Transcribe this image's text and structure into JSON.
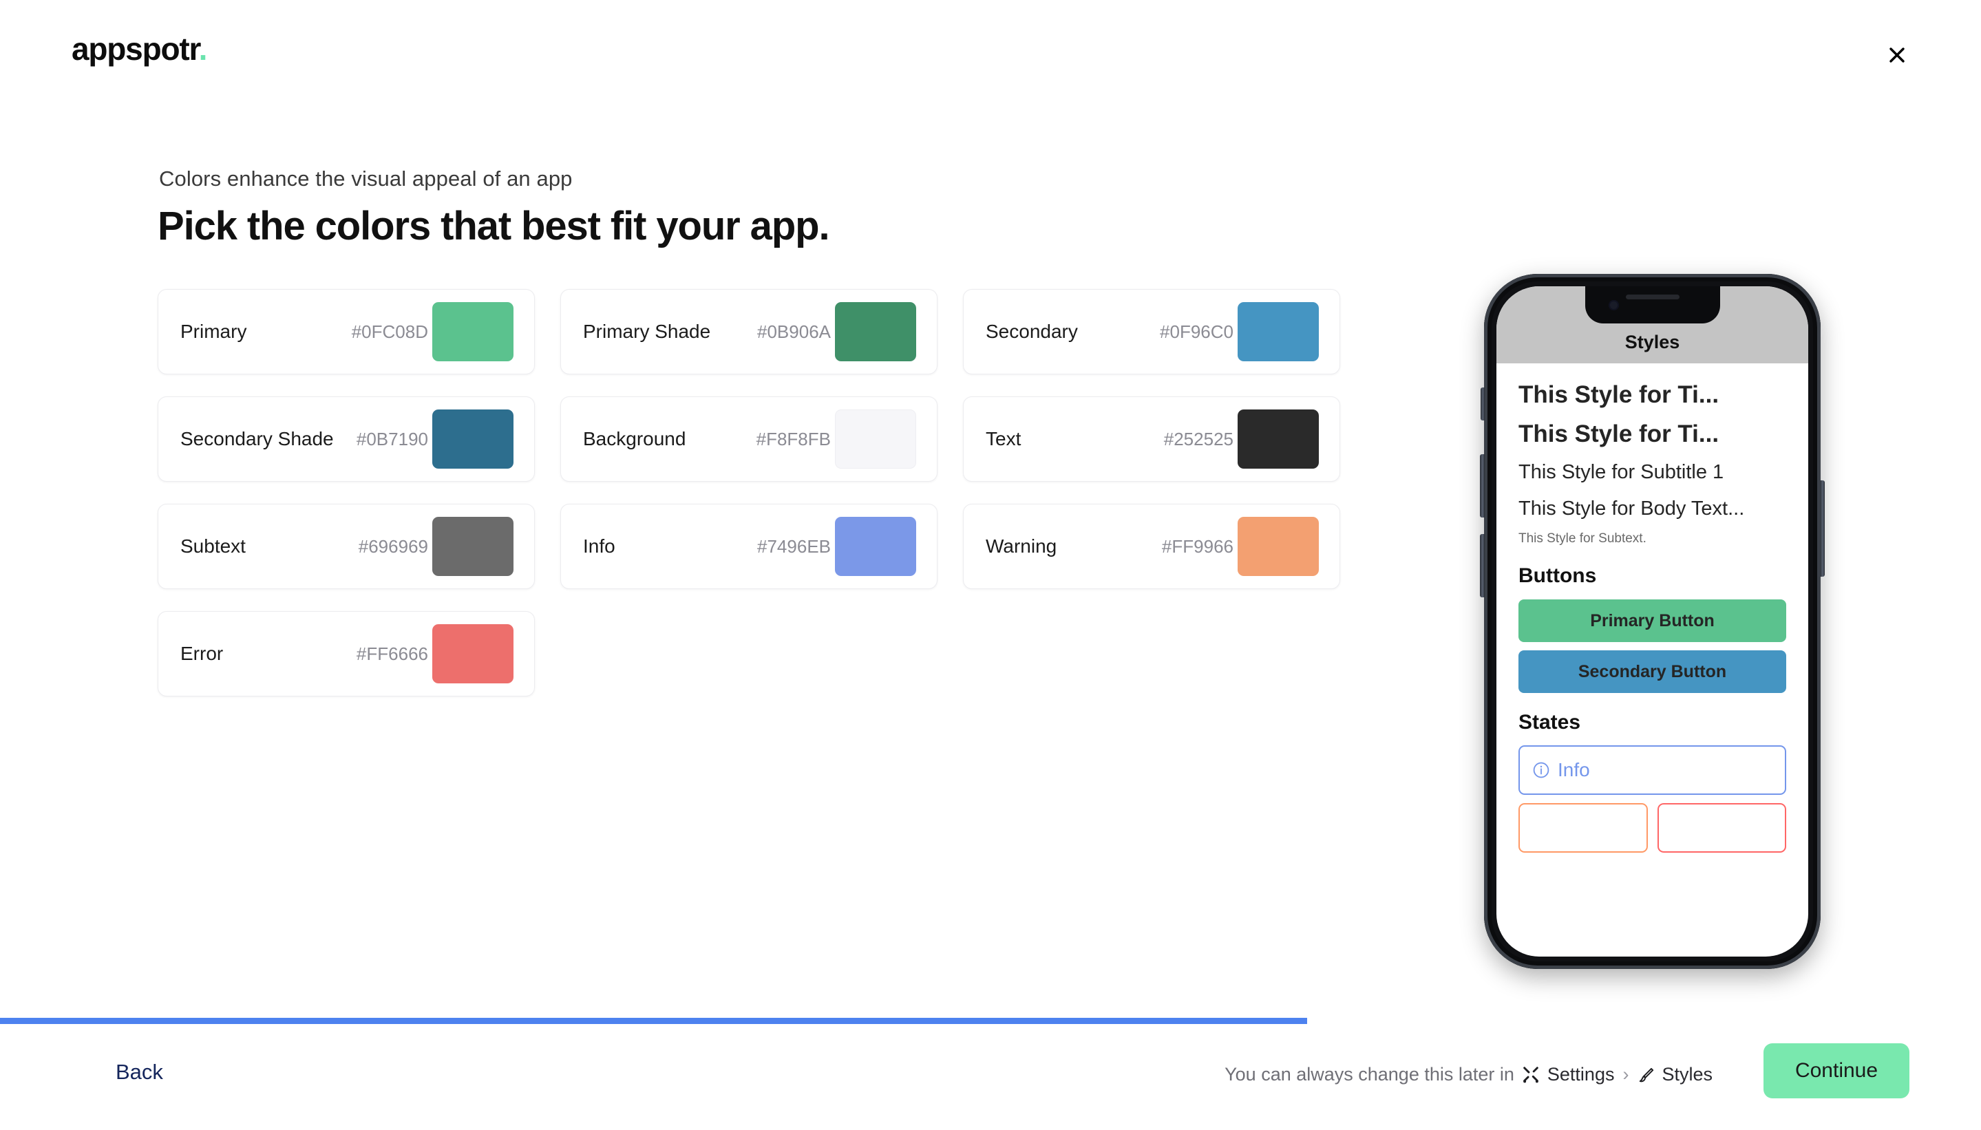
{
  "brand": {
    "name": "appspotr",
    "dot": "."
  },
  "topbar": {
    "close_label": "close-icon"
  },
  "intro": {
    "eyebrow": "Colors enhance the visual appeal of an app",
    "headline": "Pick the colors that best fit your app."
  },
  "colors": [
    {
      "name": "Primary",
      "hex": "#0FC08D",
      "swatch": "#5bc28e",
      "pale": false
    },
    {
      "name": "Primary Shade",
      "hex": "#0B906A",
      "swatch": "#3f9068",
      "pale": false
    },
    {
      "name": "Secondary",
      "hex": "#0F96C0",
      "swatch": "#4595c2",
      "pale": false
    },
    {
      "name": "Secondary Shade",
      "hex": "#0B7190",
      "swatch": "#2d6e8e",
      "pale": false
    },
    {
      "name": "Background",
      "hex": "#F8F8FB",
      "swatch": "#f6f6f9",
      "pale": true
    },
    {
      "name": "Text",
      "hex": "#252525",
      "swatch": "#2a2a2a",
      "pale": false
    },
    {
      "name": "Subtext",
      "hex": "#696969",
      "swatch": "#6b6b6b",
      "pale": false
    },
    {
      "name": "Info",
      "hex": "#7496EB",
      "swatch": "#7b98e8",
      "pale": false
    },
    {
      "name": "Warning",
      "hex": "#FF9966",
      "swatch": "#f3a071",
      "pale": false
    },
    {
      "name": "Error",
      "hex": "#FF6666",
      "swatch": "#ed6f6c",
      "pale": false
    }
  ],
  "preview": {
    "app_title": "Styles",
    "title_1": "This Style for Ti...",
    "title_2": "This Style for Ti...",
    "subtitle": "This Style for Subtitle 1",
    "body": "This Style for Body Text...",
    "subtext": "This Style for Subtext.",
    "buttons_heading": "Buttons",
    "primary_button": "Primary Button",
    "secondary_button": "Secondary Button",
    "states_heading": "States",
    "info_state": "Info",
    "primary_button_color": "#5bc28e",
    "secondary_button_color": "#4595c2",
    "info_color": "#7496EB",
    "warning_color": "#FF9966",
    "error_color": "#FF6666"
  },
  "progress": {
    "percent": 66,
    "color": "#4d82ef"
  },
  "footer": {
    "back": "Back",
    "hint_prefix": "You can always change this later in",
    "settings": "Settings",
    "chevron": "›",
    "styles": "Styles",
    "continue": "Continue"
  }
}
